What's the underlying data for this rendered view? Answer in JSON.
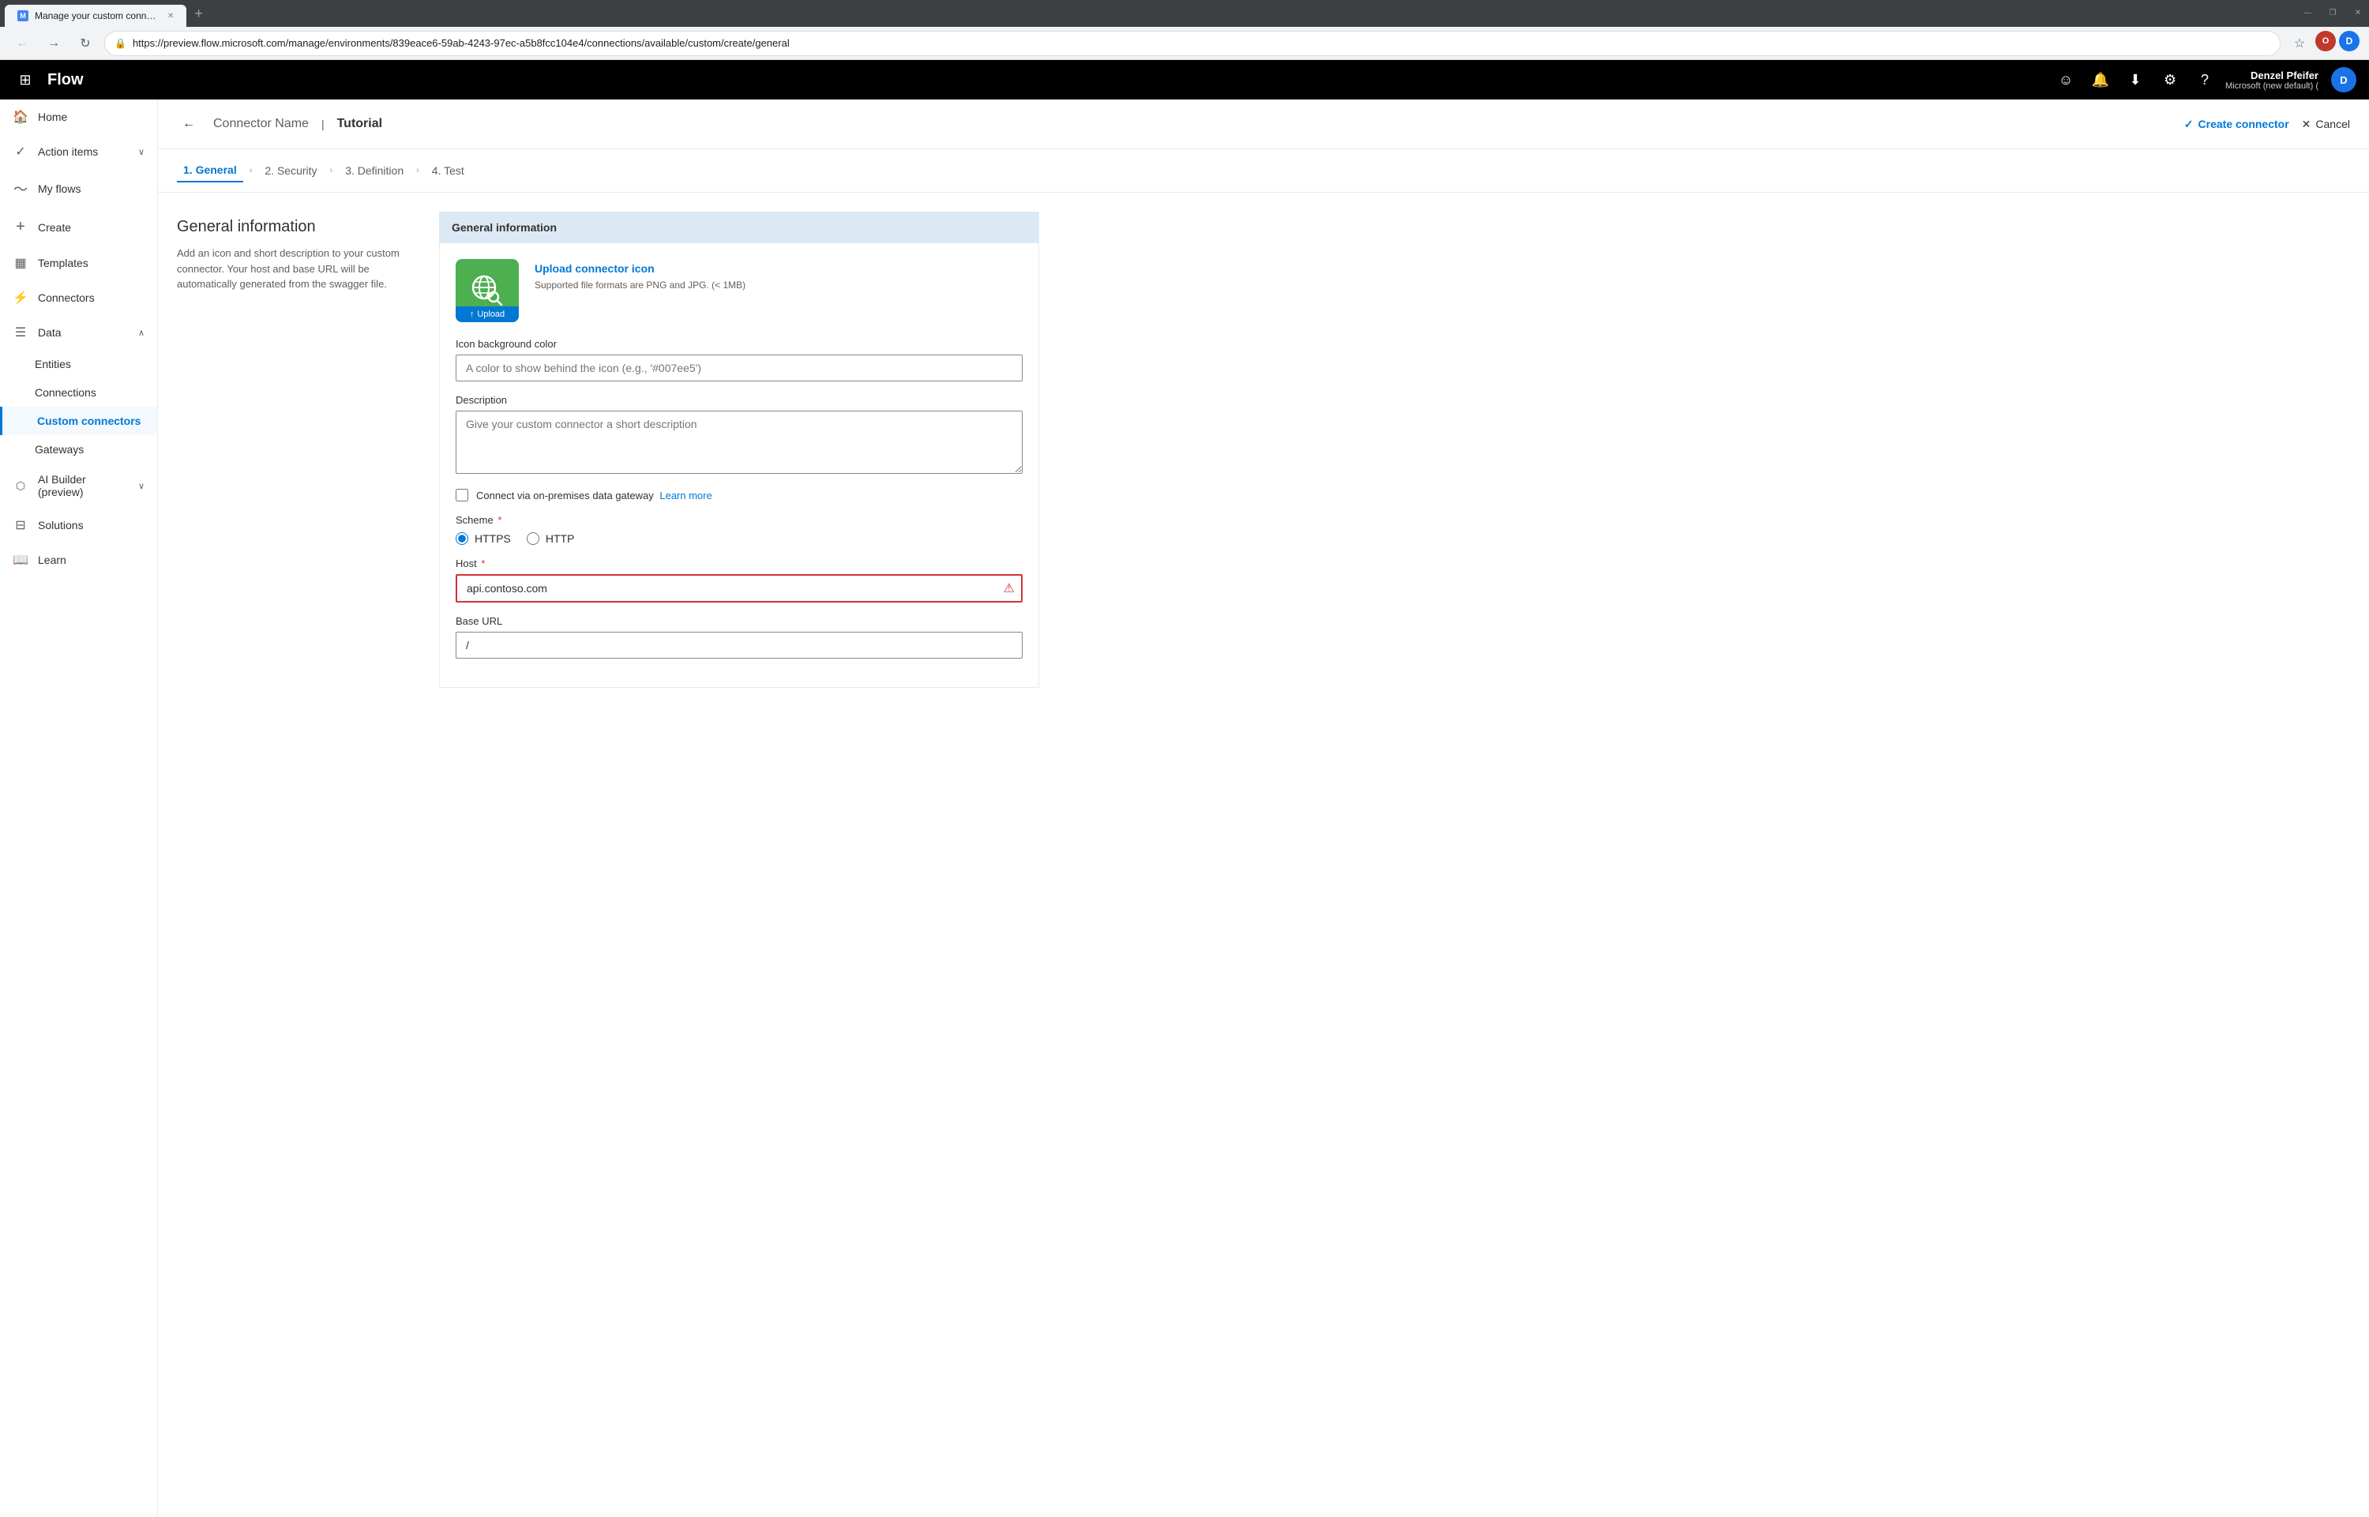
{
  "browser": {
    "tab": {
      "title": "Manage your custom connectors",
      "favicon_label": "M"
    },
    "url": "https://preview.flow.microsoft.com/manage/environments/839eace6-59ab-4243-97ec-a5b8fcc104e4/connections/available/custom/create/general",
    "new_tab_label": "+",
    "window_controls": {
      "minimize": "—",
      "maximize": "❐",
      "close": "✕"
    }
  },
  "topbar": {
    "waffle_icon": "⊞",
    "app_name": "Flow",
    "icons": {
      "feedback": "☺",
      "notifications": "🔔",
      "download": "⬇",
      "settings": "⚙",
      "help": "?"
    },
    "user": {
      "name": "Denzel Pfeifer",
      "org": "Microsoft (new default) (",
      "avatar_initials": "D"
    }
  },
  "sidebar": {
    "items": [
      {
        "id": "home",
        "label": "Home",
        "icon": "🏠",
        "expandable": false
      },
      {
        "id": "action-items",
        "label": "Action items",
        "icon": "✓",
        "expandable": true
      },
      {
        "id": "my-flows",
        "label": "My flows",
        "icon": "~",
        "expandable": false
      },
      {
        "id": "create",
        "label": "Create",
        "icon": "+",
        "expandable": false
      },
      {
        "id": "templates",
        "label": "Templates",
        "icon": "▦",
        "expandable": false
      },
      {
        "id": "connectors",
        "label": "Connectors",
        "icon": "⚡",
        "expandable": false
      },
      {
        "id": "data",
        "label": "Data",
        "icon": "☰",
        "expandable": true,
        "expanded": true
      },
      {
        "id": "entities",
        "label": "Entities",
        "sub": true
      },
      {
        "id": "connections",
        "label": "Connections",
        "sub": true
      },
      {
        "id": "custom-connectors",
        "label": "Custom connectors",
        "sub": true,
        "active": true
      },
      {
        "id": "gateways",
        "label": "Gateways",
        "sub": true
      },
      {
        "id": "ai-builder",
        "label": "AI Builder (preview)",
        "icon": "⬡",
        "expandable": true
      },
      {
        "id": "solutions",
        "label": "Solutions",
        "icon": "⊟",
        "expandable": false
      },
      {
        "id": "learn",
        "label": "Learn",
        "icon": "📖",
        "expandable": false
      }
    ]
  },
  "header": {
    "back_label": "←",
    "connector_name_label": "Connector Name",
    "page_title": "Tutorial",
    "create_connector_label": "Create connector",
    "create_icon": "✓",
    "cancel_label": "Cancel",
    "cancel_icon": "✕"
  },
  "steps": [
    {
      "id": "general",
      "label": "1. General",
      "active": true
    },
    {
      "id": "security",
      "label": "2. Security",
      "active": false
    },
    {
      "id": "definition",
      "label": "3. Definition",
      "active": false
    },
    {
      "id": "test",
      "label": "4. Test",
      "active": false
    }
  ],
  "description": {
    "title": "General information",
    "body": "Add an icon and short description to your custom connector. Your host and base URL will be automatically generated from the swagger file."
  },
  "form": {
    "section_title": "General information",
    "upload_link": "Upload connector icon",
    "upload_note": "Supported file formats are PNG and JPG. (< 1MB)",
    "upload_btn_label": "Upload",
    "icon_bg_label": "Icon background color",
    "icon_bg_placeholder": "A color to show behind the icon (e.g., '#007ee5')",
    "description_label": "Description",
    "description_placeholder": "Give your custom connector a short description",
    "checkbox_label": "Connect via on-premises data gateway",
    "learn_more": "Learn more",
    "scheme_label": "Scheme",
    "scheme_required": true,
    "scheme_options": [
      {
        "value": "HTTPS",
        "label": "HTTPS",
        "selected": true
      },
      {
        "value": "HTTP",
        "label": "HTTP",
        "selected": false
      }
    ],
    "host_label": "Host",
    "host_required": true,
    "host_value": "api.contoso.com",
    "base_url_label": "Base URL",
    "base_url_value": "/"
  }
}
